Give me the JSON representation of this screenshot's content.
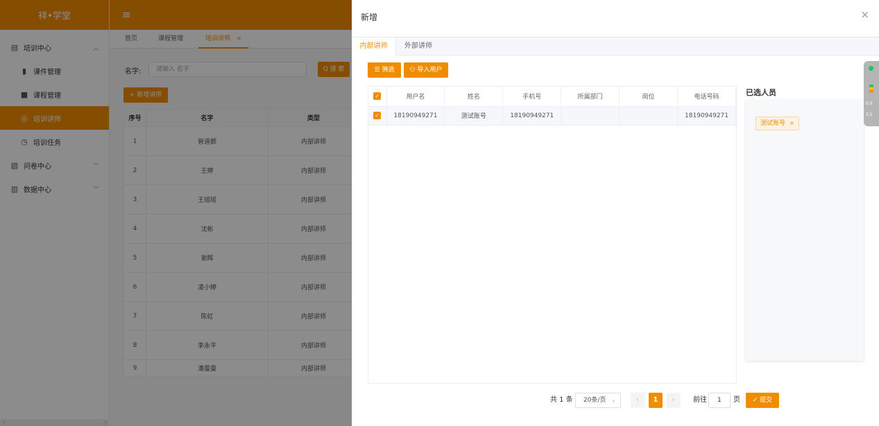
{
  "sidebar": {
    "logo": "祥•学堂",
    "items": [
      {
        "label": "培训中心",
        "icon": "document-icon",
        "chevron": "︿"
      },
      {
        "label": "课件管理",
        "icon": "file-icon"
      },
      {
        "label": "课程管理",
        "icon": "book-icon"
      },
      {
        "label": "培训讲师",
        "icon": "user-circle-icon"
      },
      {
        "label": "培训任务",
        "icon": "clock-icon"
      },
      {
        "label": "问卷中心",
        "icon": "survey-icon",
        "chevron": "﹀"
      },
      {
        "label": "数据中心",
        "icon": "chart-icon",
        "chevron": "﹀"
      }
    ]
  },
  "header": {
    "menu_icon": "≡"
  },
  "page_tabs": [
    {
      "label": "首页"
    },
    {
      "label": "课程管理"
    },
    {
      "label": "培训讲师",
      "close": "×"
    }
  ],
  "main": {
    "filter_label": "名字:",
    "filter_placeholder": "请输入 名字",
    "search_label": "Q 搜 索",
    "add_label": "+ 新增讲师",
    "table": {
      "headers": [
        "序号",
        "名字",
        "类型"
      ],
      "rows": [
        [
          "1",
          "管道颤",
          "内部讲师"
        ],
        [
          "2",
          "王婷",
          "内部讲师"
        ],
        [
          "3",
          "王瑶瑶",
          "内部讲师"
        ],
        [
          "4",
          "沈彬",
          "内部讲师"
        ],
        [
          "5",
          "谢辉",
          "内部讲师"
        ],
        [
          "6",
          "凌小婷",
          "内部讲师"
        ],
        [
          "7",
          "陈虹",
          "内部讲师"
        ],
        [
          "8",
          "李永平",
          "内部讲师"
        ],
        [
          "9",
          "潘曼曼",
          "内部讲师"
        ]
      ]
    }
  },
  "drawer": {
    "title": "新增",
    "close": "×",
    "tabs": [
      {
        "label": "内部讲师"
      },
      {
        "label": "外部讲师"
      }
    ],
    "filter_btn": "☰ 筛选",
    "import_btn": "⚇ 导入用户",
    "user_table": {
      "headers": [
        "用户名",
        "姓名",
        "手机号",
        "所属部门",
        "岗位",
        "电话号码"
      ],
      "rows": [
        [
          "18190949271",
          "测试账号",
          "18190949271",
          "",
          "",
          "18190949271"
        ]
      ]
    },
    "selected_title": "已选人员",
    "selected_tag": "测试账号",
    "tag_close": "×",
    "pagination": {
      "total": "共 1 条",
      "page_size": "20条/页",
      "current": "1",
      "goto_prefix": "前往",
      "goto_value": "1",
      "goto_suffix": "页",
      "prev": "‹",
      "next": "›",
      "size_arrow": "⌄"
    },
    "submit": "✓ 提交"
  },
  "widget": {
    "line1": "0.0",
    "line2": "3.5"
  },
  "colors": {
    "brand": "#f08c00"
  }
}
